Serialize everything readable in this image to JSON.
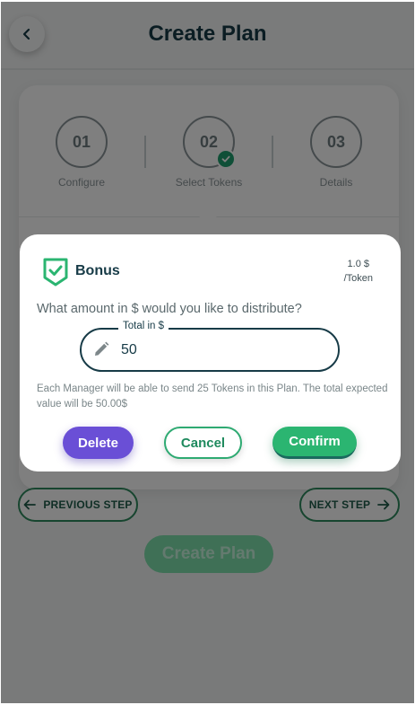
{
  "header": {
    "title": "Create Plan"
  },
  "steps": [
    {
      "number": "01",
      "label": "Configure"
    },
    {
      "number": "02",
      "label": "Select Tokens"
    },
    {
      "number": "03",
      "label": "Details"
    }
  ],
  "navigation": {
    "previous_label": "PREVIOUS STEP",
    "next_label": "NEXT STEP",
    "create_label": "Create Plan"
  },
  "modal": {
    "title": "Bonus",
    "price_value": "1.0 $",
    "price_unit": "/Token",
    "question": "What amount in $ would you like to distribute?",
    "field_label": "Total in $",
    "field_value": "50",
    "info": "Each Manager will be able to send 25 Tokens in this Plan. The total expected value will be 50.00$",
    "delete_label": "Delete",
    "cancel_label": "Cancel",
    "confirm_label": "Confirm"
  },
  "colors": {
    "primary_dark": "#173b47",
    "accent_green": "#2bb571",
    "delete_purple": "#6a4fd6"
  }
}
